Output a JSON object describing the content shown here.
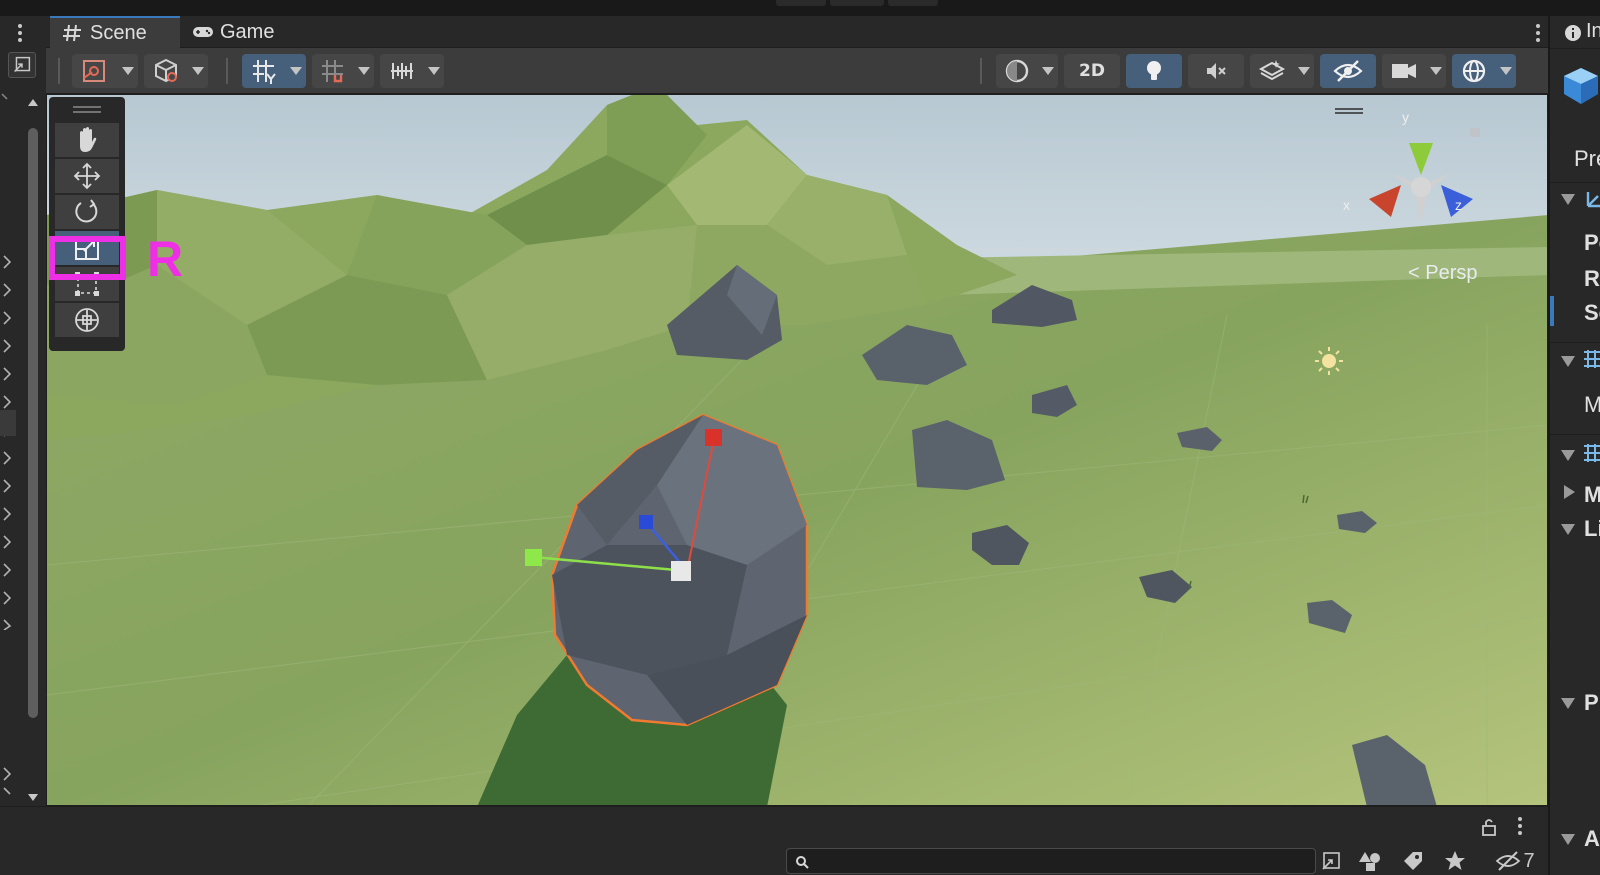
{
  "tabs": [
    {
      "label": "Scene",
      "icon": "grid-hash-icon",
      "active": true
    },
    {
      "label": "Game",
      "icon": "gamepad-icon",
      "active": false
    }
  ],
  "toolbar": {
    "mode_2d_label": "2D",
    "lighting_enabled": true,
    "visibility_enabled": true,
    "gizmos_enabled": true,
    "grid_snapping_enabled": true
  },
  "viewport": {
    "projection_label": "Persp",
    "gizmo_axes": {
      "x": "x",
      "y": "y",
      "z": "z"
    }
  },
  "tools_palette": {
    "tools": [
      "hand-tool-icon",
      "move-tool-icon",
      "rotate-tool-icon",
      "scale-tool-icon",
      "rect-tool-icon",
      "transform-tool-icon"
    ],
    "selected": "scale-tool-icon"
  },
  "annotation": {
    "letter": "R",
    "color": "#ef2fe5"
  },
  "inspector": {
    "header": "In",
    "items": [
      "Pre",
      "Po",
      "Ro",
      "Sc",
      "M",
      "M",
      "Li",
      "Pr",
      "A"
    ]
  },
  "bottom": {
    "search_placeholder": "",
    "hidden_count": "7"
  },
  "colors": {
    "panel_dark": "#282828",
    "panel_mid": "#3c3c3c",
    "active_blue": "#46607c",
    "tab_accent": "#3a79bb",
    "selection_orange": "#f07a30",
    "terrain_green": "#8fae66",
    "rock_gray": "#5a616a"
  }
}
